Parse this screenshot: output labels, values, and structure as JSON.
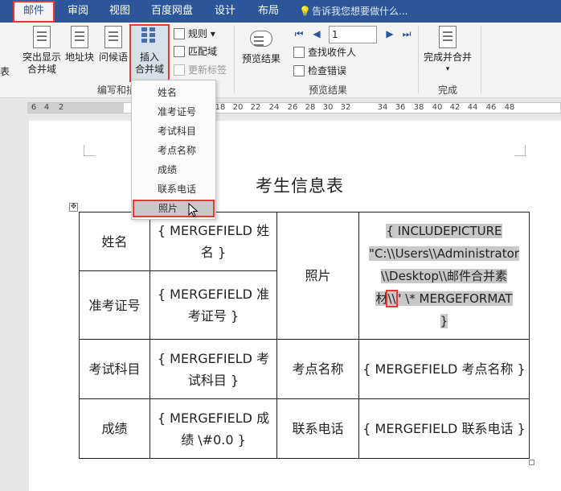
{
  "tabs": [
    {
      "label": "邮件",
      "active": true
    },
    {
      "label": "审阅"
    },
    {
      "label": "视图"
    },
    {
      "label": "百度网盘"
    },
    {
      "label": "设计"
    },
    {
      "label": "布局"
    }
  ],
  "tell_me": "告诉我您想要做什么...",
  "ribbon": {
    "left_cut_label": "表",
    "highlight_fields_label": "突出显示\n合并域",
    "address_block_label": "地址块",
    "greeting_label": "问候语",
    "insert_field_label": "插入\n合并域",
    "rules_label": "规则",
    "match_fields_label": "匹配域",
    "update_labels_label": "更新标签",
    "preview_results_label": "预览结果",
    "record_number": "1",
    "find_recipient_label": "查找收件人",
    "check_errors_label": "检查错误",
    "finish_merge_label": "完成并合并",
    "group_write_insert": "编写和插",
    "group_preview": "预览结果",
    "group_finish": "完成"
  },
  "ruler_numbers": [
    "6",
    "4",
    "2",
    "18",
    "20",
    "22",
    "24",
    "26",
    "28",
    "30",
    "32",
    "34",
    "36",
    "38",
    "40",
    "42",
    "44",
    "46",
    "48"
  ],
  "dropdown": {
    "items": [
      "姓名",
      "准考证号",
      "考试科目",
      "考点名称",
      "成绩",
      "联系电话",
      "照片"
    ],
    "hovered": "照片"
  },
  "document": {
    "title": "考生信息表",
    "rows": [
      {
        "label": "姓名",
        "field": "{ MERGEFIELD 姓名 }"
      },
      {
        "label": "准考证号",
        "field": "{ MERGEFIELD 准考证号 }"
      }
    ],
    "photo_label": "照片",
    "photo_field_line1": "{ INCLUDEPICTURE",
    "photo_field_line2": "\"C:\\\\Users\\\\Administrator",
    "photo_field_line3": "\\\\Desktop\\\\邮件合并素",
    "photo_field_line4a": "材",
    "photo_field_line4b": "\\\\",
    "photo_field_line4c": "\"   \\* MERGEFORMAT",
    "photo_field_line5": "}",
    "exam_subject_label": "考试科目",
    "exam_subject_field": "{ MERGEFIELD 考试科目 }",
    "exam_site_label": "考点名称",
    "exam_site_field": "{ MERGEFIELD 考点名称 }",
    "score_label": "成绩",
    "score_field": "{ MERGEFIELD 成绩 \\#0.0 }",
    "phone_label": "联系电话",
    "phone_field": "{ MERGEFIELD 联系电话 }"
  }
}
